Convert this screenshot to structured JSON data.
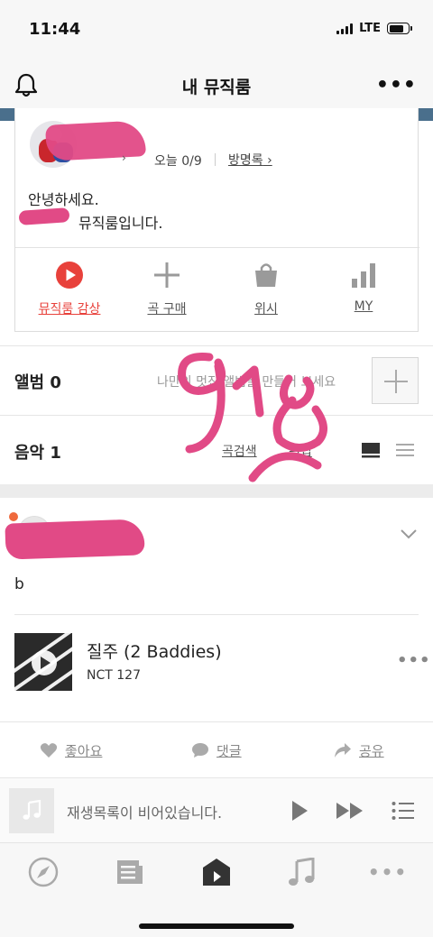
{
  "status_bar": {
    "time": "11:44",
    "network": "LTE"
  },
  "header": {
    "title": "내 뮤직룸"
  },
  "profile": {
    "today_label": "오늘 0/9",
    "guestbook_label": "방명록",
    "greeting_line1": "안녕하세요.",
    "greeting_line2": "뮤직룸입니다."
  },
  "actions": [
    {
      "label": "뮤직룸 감상",
      "icon": "play-circle-icon",
      "active": true
    },
    {
      "label": "곡 구매",
      "icon": "plus-icon"
    },
    {
      "label": "위시",
      "icon": "shopping-bag-icon"
    },
    {
      "label": "MY",
      "icon": "bar-chart-icon"
    }
  ],
  "album": {
    "label": "앨범 0",
    "hint": "나만의 멋진 앨범을 만들어 보세요"
  },
  "music": {
    "label": "음악 1",
    "search_label": "곡검색",
    "edit_label": "편집"
  },
  "post": {
    "text": "b",
    "song": {
      "title": "질주 (2 Baddies)",
      "artist": "NCT 127"
    }
  },
  "social": {
    "like_label": "좋아요",
    "comment_label": "댓글",
    "share_label": "공유"
  },
  "mini_player": {
    "empty_text": "재생목록이 비어있습니다."
  },
  "tabs": [
    "compass-icon",
    "news-icon",
    "music-room-icon",
    "music-note-icon",
    "more-icon"
  ],
  "colors": {
    "accent": "#e8413b",
    "scribble": "#e14a86",
    "icon_gray": "#9a9a9a"
  }
}
